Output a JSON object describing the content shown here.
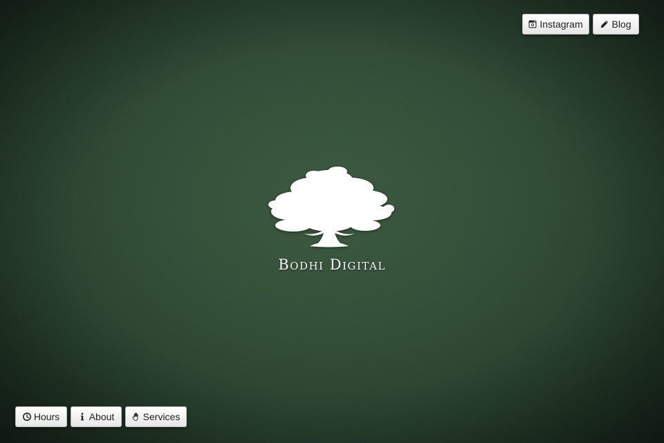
{
  "brand": {
    "name": "Bodhi Digital",
    "logo_icon": "bodhi-tree-icon"
  },
  "top_nav": {
    "instagram_label": "Instagram",
    "instagram_icon": "instagram-icon",
    "blog_label": "Blog",
    "blog_icon": "pencil-icon"
  },
  "bottom_nav": {
    "hours_label": "Hours",
    "hours_icon": "clock-icon",
    "about_label": "About",
    "about_icon": "info-icon",
    "services_label": "Services",
    "services_icon": "hand-icon"
  },
  "colors": {
    "background": "#34503a",
    "button_bg": "#ffffff",
    "button_text": "#222222",
    "logo": "#ffffff"
  }
}
